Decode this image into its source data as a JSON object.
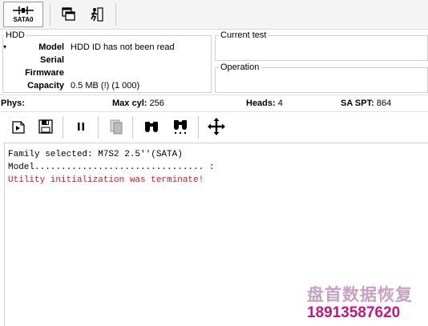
{
  "toolbar": {
    "sata_label": "SATA0",
    "icons": [
      "sata-port-icon",
      "copy-windows-icon",
      "run-person-icon"
    ]
  },
  "hdd": {
    "group_title": "HDD",
    "fields": [
      {
        "label": "Model",
        "value": "HDD ID has not been read"
      },
      {
        "label": "Serial",
        "value": ""
      },
      {
        "label": "Firmware",
        "value": ""
      },
      {
        "label": "Capacity",
        "value": "0.5 MB (!) (1 000)"
      }
    ]
  },
  "current_test": {
    "title": "Current test"
  },
  "operation": {
    "title": "Operation"
  },
  "phys": {
    "phys_label": "Phys:",
    "maxcyl_label": "Max cyl:",
    "maxcyl_value": "256",
    "heads_label": "Heads:",
    "heads_value": "4",
    "saspt_label": "SA SPT:",
    "saspt_value": "864"
  },
  "tools": {
    "icons": [
      "load-module-icon",
      "save-module-icon",
      "pause-icon",
      "copy-disabled-icon",
      "binoculars-icon",
      "binoculars-find-icon",
      "move-arrows-icon"
    ]
  },
  "log": {
    "lines": [
      {
        "text": "Family selected: M7S2 2.5''(SATA)",
        "color": "#000000"
      },
      {
        "text": "Model................................ :",
        "color": "#000000"
      },
      {
        "text": "Utility initialization was terminate!",
        "color": "#e0141e"
      }
    ]
  },
  "watermark": {
    "line1": "盘首数据恢复",
    "line2": "18913587620",
    "color": "#c71585"
  },
  "colors": {
    "error": "#e0141e",
    "watermark": "#c71585"
  }
}
